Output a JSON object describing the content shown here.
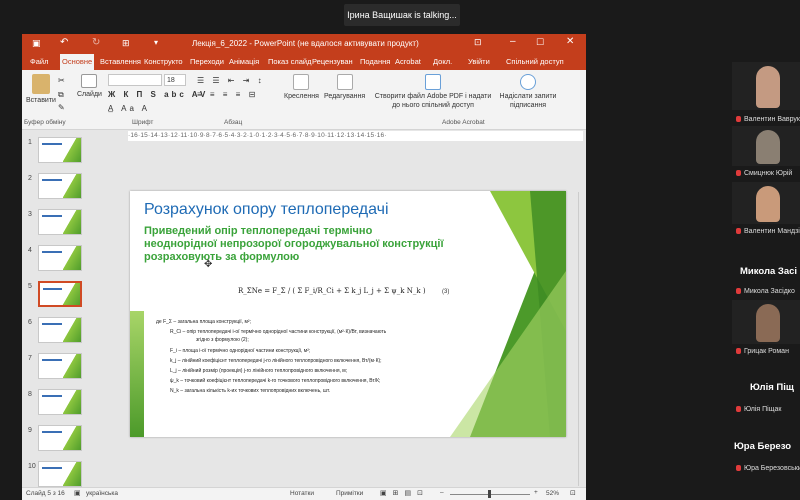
{
  "zoom": {
    "speaking_banner": "Ірина Ващишак is talking..."
  },
  "powerpoint": {
    "window_title": "Лекція_6_2022 - PowerPoint (не вдалося активувати продукт)",
    "tabs": [
      "Файл",
      "Основне",
      "Вставлення",
      "Конструкто",
      "Переходи",
      "Анімація",
      "Показ слайд",
      "Рецензуван",
      "Подання",
      "Acrobat",
      "Докл.",
      "Увійти",
      "Спільний доступ"
    ],
    "active_tab": "Основне",
    "ribbon": {
      "paste": "Вставити",
      "slides": "Слайди",
      "font_size": "18",
      "drawing": "Креслення",
      "editing": "Редагування",
      "create_pdf": "Створити файл Adobe PDF і надати до нього спільний доступ",
      "request_signatures": "Надіслати запити підписання",
      "groups": {
        "clipboard": "Буфер обміну",
        "font": "Шрифт",
        "paragraph": "Абзац",
        "adobe": "Adobe Acrobat"
      }
    },
    "ruler_text": "·16·15·14·13·12·11·10·9·8·7·6·5·4·3·2·1·0·1·2·3·4·5·6·7·8·9·10·11·12·13·14·15·16·",
    "slide_numbers": [
      "1",
      "2",
      "3",
      "4",
      "5",
      "6",
      "7",
      "8",
      "9",
      "10"
    ],
    "selected_slide": "5",
    "slide": {
      "title": "Розрахунок опору теплопередачі",
      "subtitle": "Приведений опір теплопередачі термічно неоднорідної непрозорої огороджувальної конструкції розраховують за формулою",
      "formula": "R_ΣNe = F_Σ / ( Σ F_i/R_Ci + Σ k_j L_j + Σ ψ_k N_k )",
      "formula_number": "(3)",
      "definitions": [
        "де  F_Σ   – загальна площа конструкції, м²;",
        "R_Ci   – опір теплопередачі і-ої термічно однорідної частини конструкції, (м²·К)/Вт, визначають",
        "згідно з формулою (2);",
        "F_i    – площа і-ої термічно однорідної частини конструкції, м²;",
        "k_j    – лінійний коефіцієнт теплопередачі j-го лінійного теплопровідного включення, Вт/(м·К);",
        "L_j    – лінійний розмір (проекція) j-го лінійного теплопровідного включення, м;",
        "ψ_k   – точковий коефіцієнт теплопередачі k-го точкового теплопровідного включення, Вт/К;",
        "N_k    – загальна кількість k-их точкових теплопровідних включень, шт."
      ]
    },
    "status": {
      "slide_of": "Слайд 5 з 16",
      "language": "українська",
      "notes": "Нотатки",
      "comments": "Примітки",
      "zoom": "52%"
    }
  },
  "participants": [
    {
      "name": "Валентин Ваврук",
      "big_name": ""
    },
    {
      "name": "Смицнюк Юрій",
      "big_name": ""
    },
    {
      "name": "Валентин Мандзій",
      "big_name": ""
    },
    {
      "name": "Микола Засідко",
      "big_name": "Микола Засі"
    },
    {
      "name": "Грицак Роман",
      "big_name": ""
    },
    {
      "name": "Юлія Піщак",
      "big_name": "Юлія Піщ"
    },
    {
      "name": "Юра Березовський",
      "big_name": "Юра Березо"
    }
  ],
  "colors": {
    "ppt_red": "#c43e1c",
    "slide_title_blue": "#1f6bb5",
    "slide_green": "#3aa33a",
    "mic_red": "#e03b3b"
  }
}
